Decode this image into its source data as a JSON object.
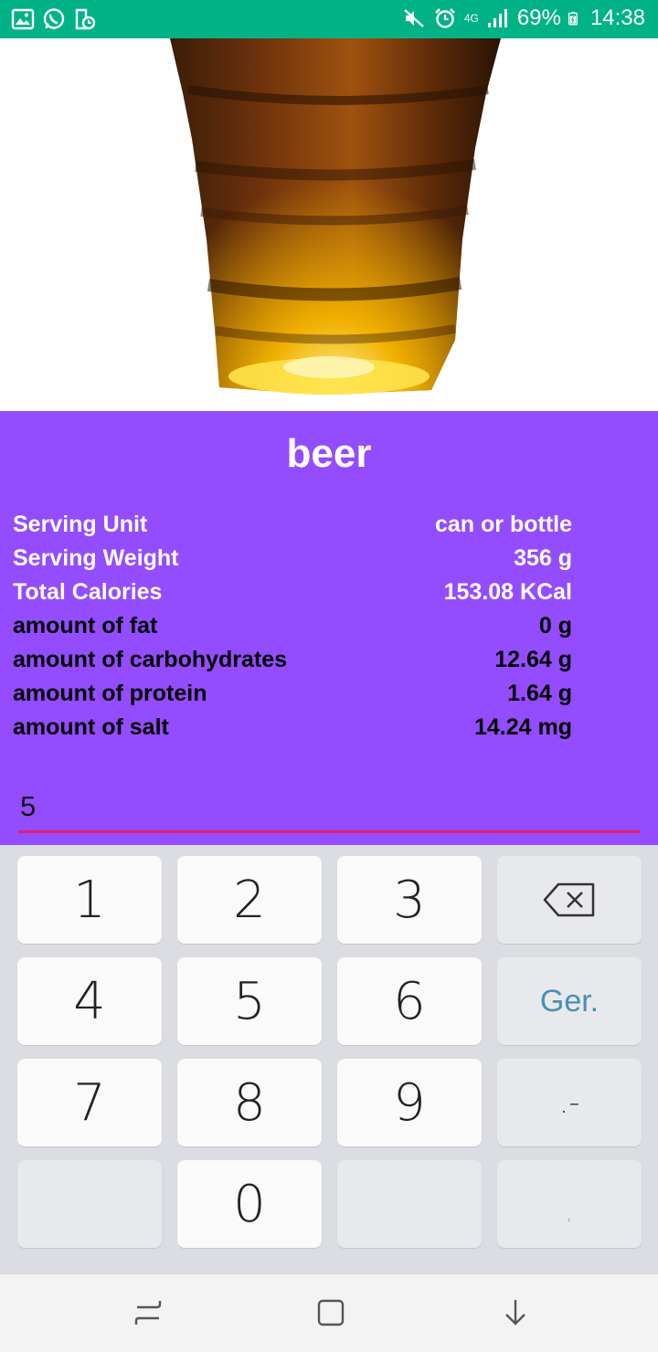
{
  "status_bar": {
    "left_icons": [
      "gallery-icon",
      "whatsapp-icon",
      "clock-file-icon"
    ],
    "network": "4G",
    "battery": "69%",
    "time": "14:38"
  },
  "product": {
    "title": "beer",
    "image": "beer-cup-image"
  },
  "nutrients": [
    {
      "label": "Serving Unit",
      "value": "can or bottle",
      "style": "light"
    },
    {
      "label": "Serving Weight",
      "value": "356 g",
      "style": "light"
    },
    {
      "label": "Total Calories",
      "value": "153.08 KCal",
      "style": "light"
    },
    {
      "label": "amount of fat",
      "value": "0 g",
      "style": "dark"
    },
    {
      "label": "amount of carbohydrates",
      "value": "12.64 g",
      "style": "dark"
    },
    {
      "label": "amount of protein",
      "value": "1.64 g",
      "style": "dark"
    },
    {
      "label": "amount of salt",
      "value": "14.24 mg",
      "style": "dark"
    }
  ],
  "quantity": {
    "value": "5"
  },
  "keyboard": {
    "keys": [
      "1",
      "2",
      "3",
      "4",
      "5",
      "6",
      "Ger.",
      "7",
      "8",
      "9",
      ".-",
      "0",
      ","
    ],
    "enter_label": "Ger."
  },
  "colors": {
    "status_bar": "#00b386",
    "panel": "#944cff",
    "underline": "#e0206e",
    "keyboard_bg": "#dcdde2"
  }
}
